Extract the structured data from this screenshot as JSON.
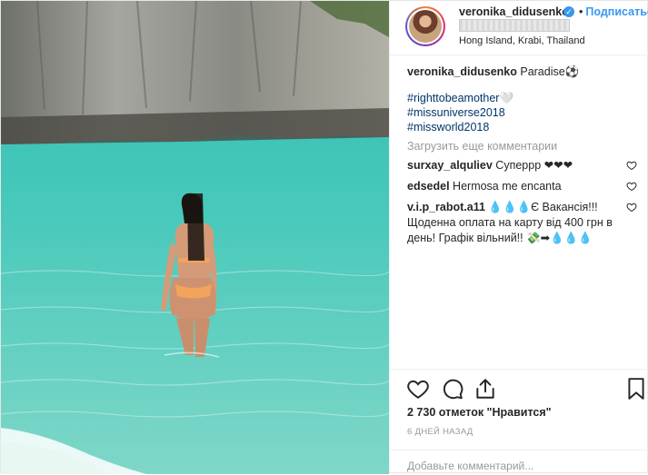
{
  "header": {
    "username": "veronika_didusenko",
    "follow_label": "Подписаться",
    "follow_separator": "•",
    "location": "Hong Island, Krabi, Thailand"
  },
  "caption": {
    "user": "veronika_didusenko",
    "text": "Paradise⚽"
  },
  "hashtags": [
    "#righttobeamother🤍",
    "#missuniverse2018",
    "#missworld2018"
  ],
  "load_more": "Загрузить еще комментарии",
  "comments": [
    {
      "user": "surxay_alquliev",
      "text": "Суперрр ❤❤❤"
    },
    {
      "user": "edsedel",
      "text": "Hermosa me encanta"
    },
    {
      "user": "v.i.p_rabot.a11",
      "text": "💧💧💧Є Вакансія!!! Щоденна оплата на карту від 400 грн в день! Графік вільний!! 💸➡💧💧💧"
    }
  ],
  "likes": "2 730 отметок \"Нравится\"",
  "date": "6 ДНЕЙ НАЗАД",
  "add_comment_placeholder": "Добавьте комментарий...",
  "colors": {
    "accent": "#3897f0",
    "hashtag": "#003569",
    "muted": "#999999",
    "water": "#3ec2b3"
  },
  "icons": {
    "like": "heart-icon",
    "comment": "comment-icon",
    "share": "share-icon",
    "save": "bookmark-icon",
    "verified": "verified-badge-icon"
  }
}
